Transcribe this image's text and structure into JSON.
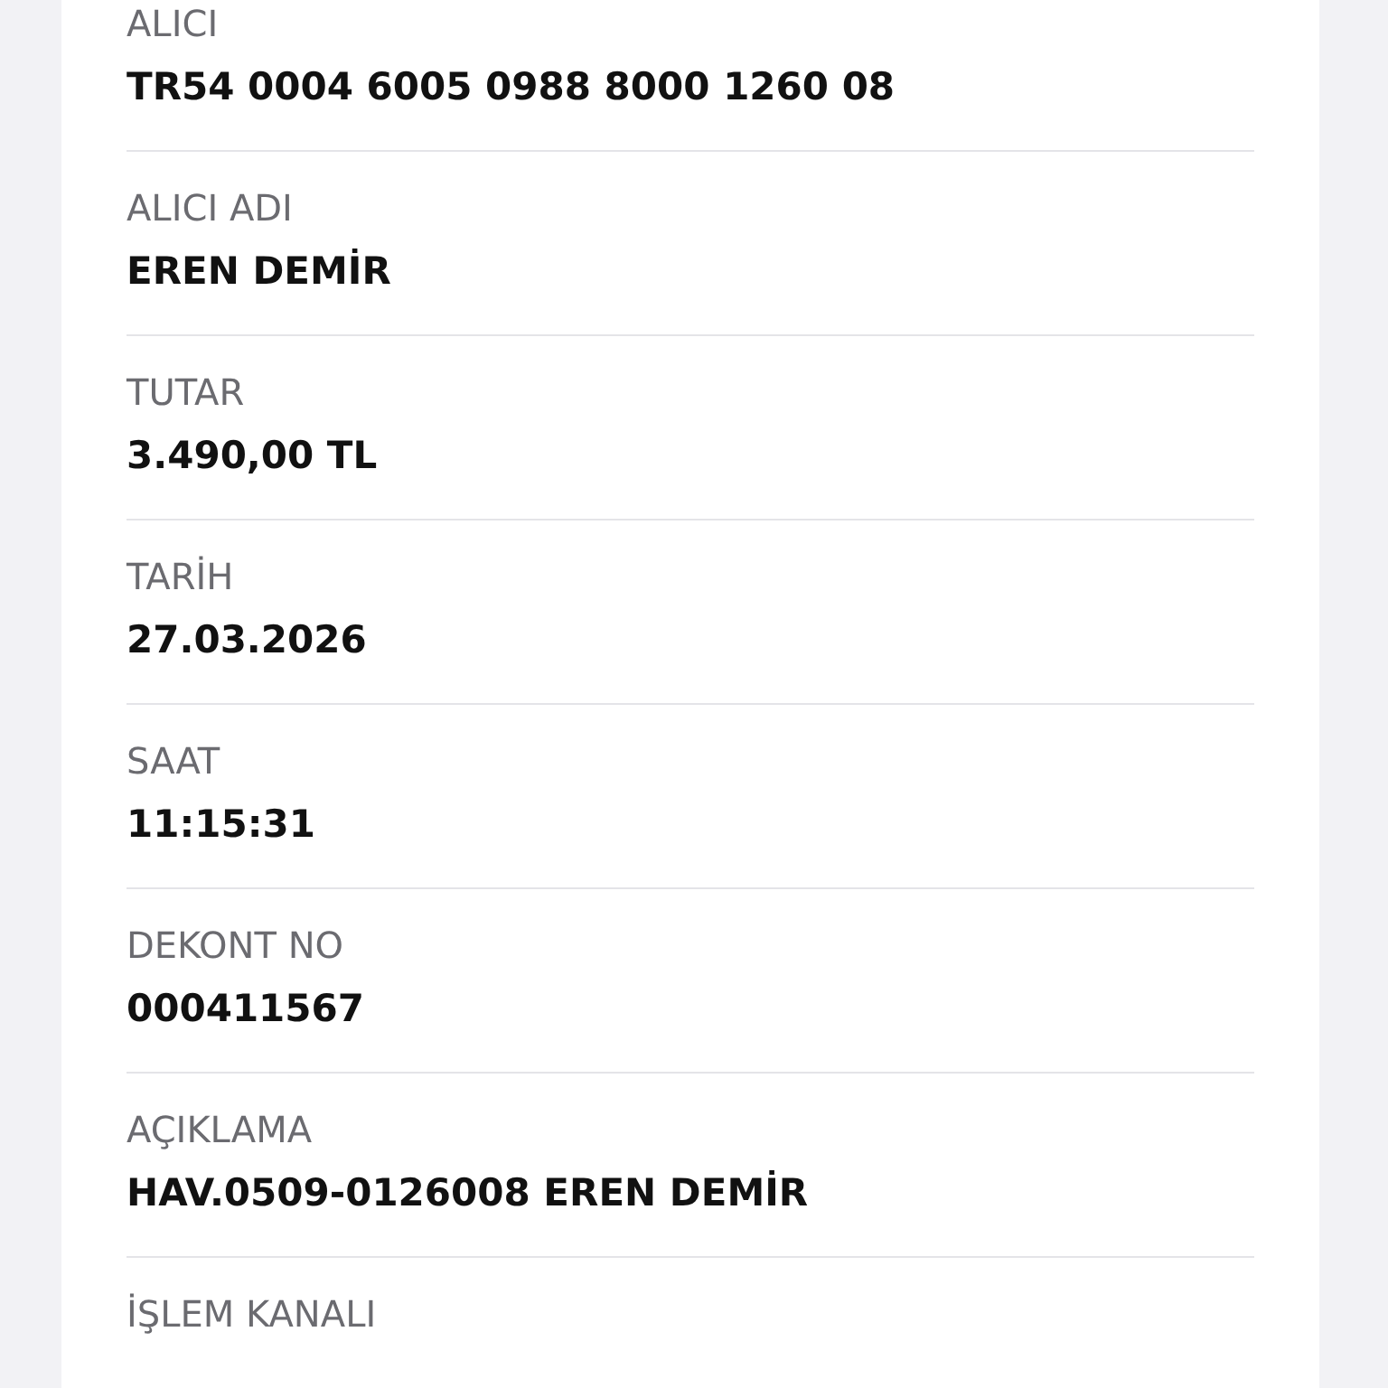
{
  "fields": [
    {
      "label": "ALICI",
      "value": "TR54 0004 6005 0988 8000 1260 08"
    },
    {
      "label": "ALICI ADI",
      "value": "EREN DEMİR"
    },
    {
      "label": "TUTAR",
      "value": "3.490,00 TL"
    },
    {
      "label": "TARİH",
      "value": "27.03.2026"
    },
    {
      "label": "SAAT",
      "value": "11:15:31"
    },
    {
      "label": "DEKONT NO",
      "value": "000411567"
    },
    {
      "label": "AÇIKLAMA",
      "value": "HAV.0509-0126008 EREN DEMİR"
    },
    {
      "label": "İŞLEM KANALI"
    }
  ]
}
